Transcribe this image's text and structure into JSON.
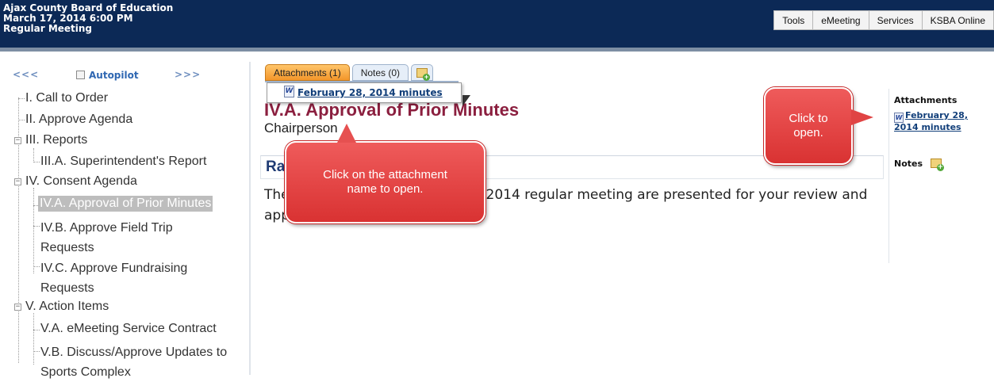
{
  "header": {
    "org": "Ajax County Board of Education",
    "datetime": "March 17, 2014 6:00 PM",
    "meeting_type": "Regular Meeting",
    "nav": [
      "Tools",
      "eMeeting",
      "Services",
      "KSBA Online"
    ]
  },
  "sidebar": {
    "prev": "<<<",
    "next": ">>>",
    "autopilot_label": "Autopilot",
    "items": [
      "I. Call to Order",
      "II. Approve Agenda",
      "III. Reports",
      "III.A. Superintendent's Report",
      "IV. Consent Agenda",
      "IV.A. Approval of Prior Minutes",
      "IV.B. Approve Field Trip Requests",
      "IV.C. Approve Fundraising Requests",
      "V. Action Items",
      "V.A. eMeeting Service Contract",
      "V.B. Discuss/Approve Updates to Sports Complex"
    ]
  },
  "tabs": {
    "attachments": "Attachments (1)",
    "notes": "Notes (0)"
  },
  "dropdown": {
    "attachment_link": "February 28, 2014 minutes"
  },
  "main": {
    "title": "IV.A. Approval of Prior Minutes",
    "presenter": "Chairperson",
    "rationale_heading": "Rationale",
    "body": "The minutes of the February 28, 2014 regular meeting are presented for your review and approval."
  },
  "right_rail": {
    "attachments_heading": "Attachments",
    "attachment_link": "February 28, 2014 minutes",
    "notes_heading": "Notes"
  },
  "callouts": {
    "left": "Click on the attachment name to open.",
    "right": "Click to open."
  },
  "colors": {
    "header_bg": "#0c2956",
    "title": "#8b1f3f",
    "rationale": "#1f3b74",
    "callout": "#e04040",
    "active_tab": "#f3962a"
  },
  "icons": {
    "doc": "word-doc-icon",
    "add": "add-note-icon"
  }
}
